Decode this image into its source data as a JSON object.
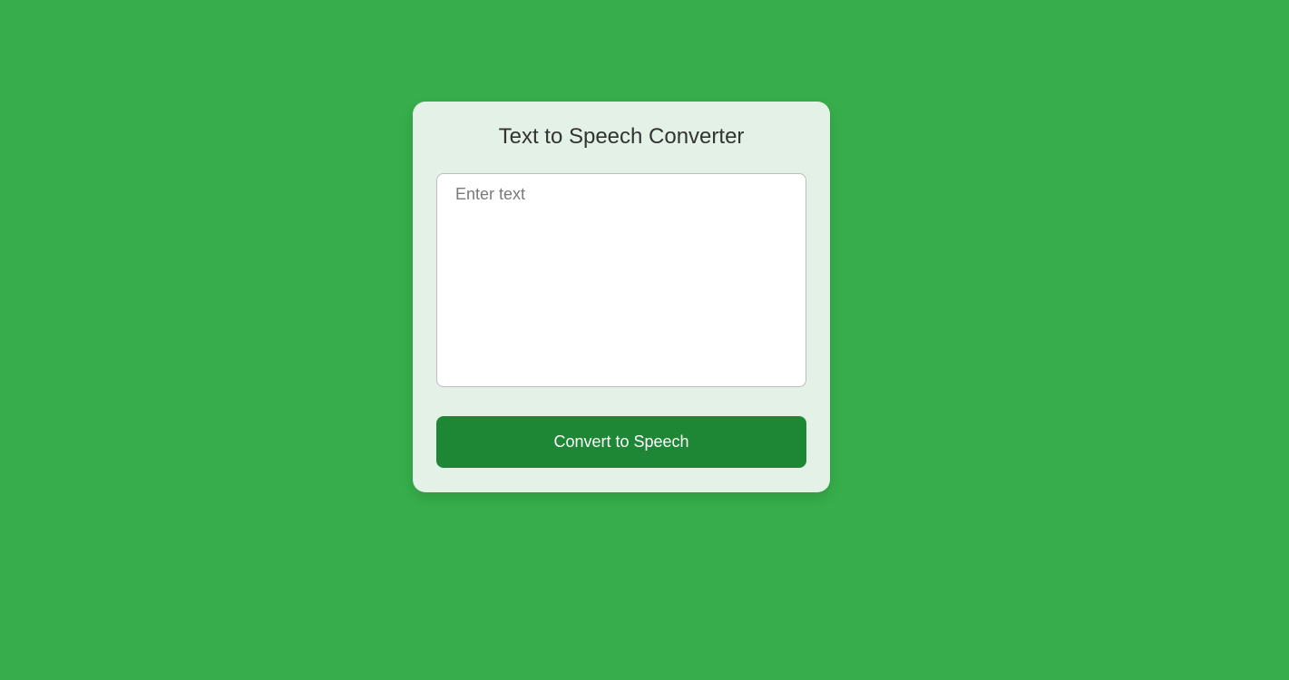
{
  "colors": {
    "background": "#37ae4b",
    "card": "#e3f1e6",
    "button": "#1d8735",
    "button_text": "#ffffff",
    "title_text": "#333333"
  },
  "card": {
    "title": "Text to Speech Converter",
    "text_input": {
      "value": "",
      "placeholder": "Enter text"
    },
    "convert_button_label": "Convert to Speech"
  }
}
